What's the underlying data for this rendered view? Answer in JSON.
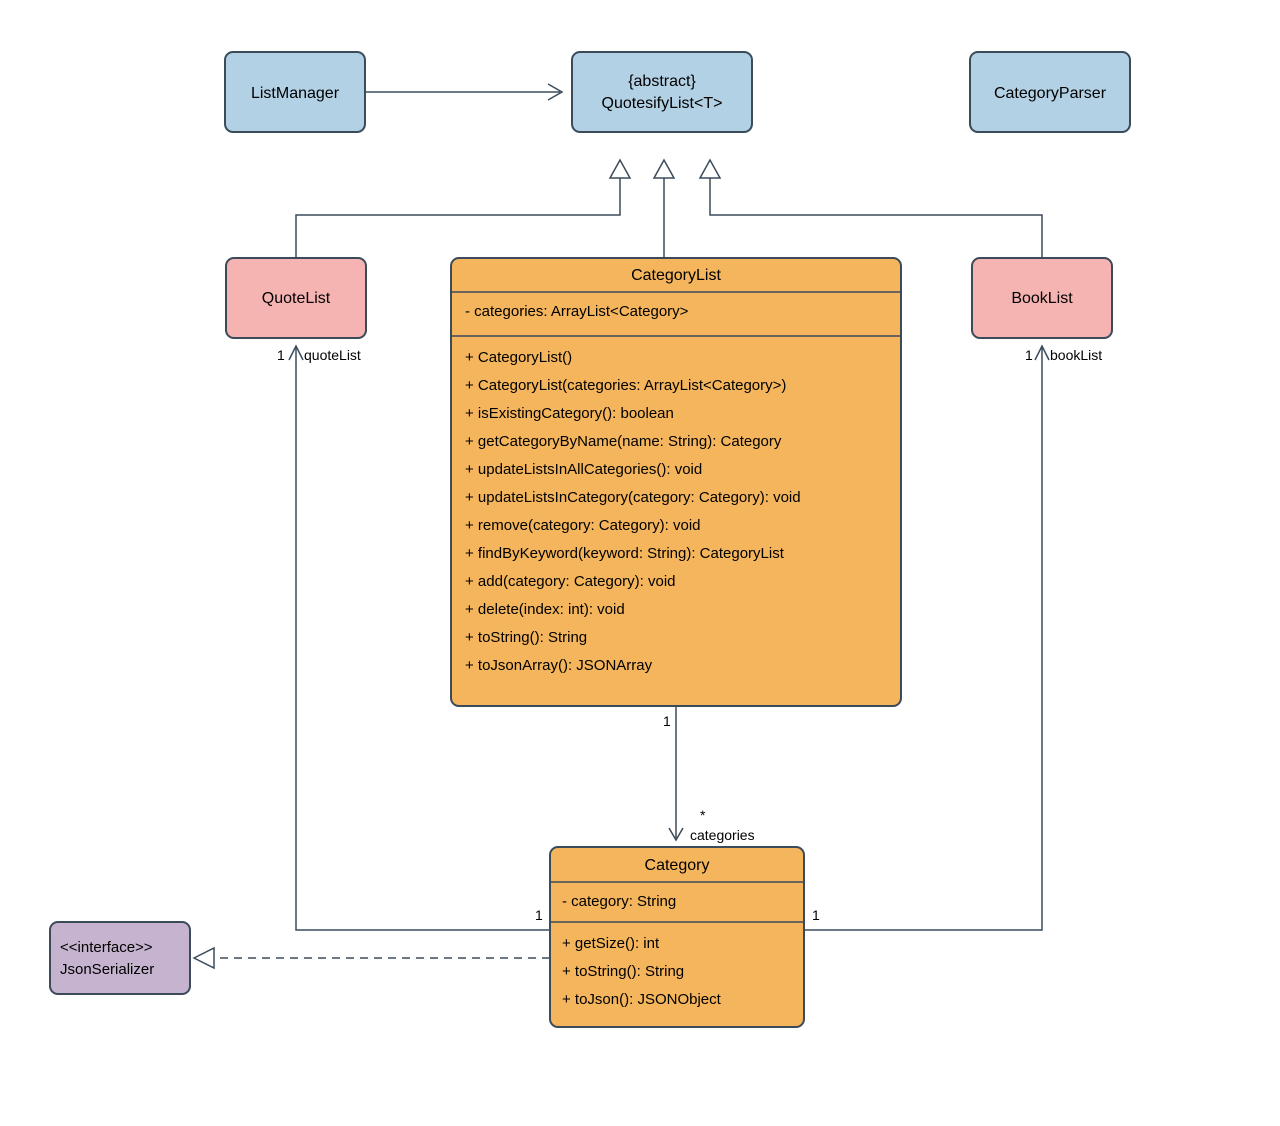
{
  "classes": {
    "listManager": {
      "name": "ListManager"
    },
    "quotesifyList": {
      "stereotype": "{abstract}",
      "name": "QuotesifyList<T>"
    },
    "categoryParser": {
      "name": "CategoryParser"
    },
    "quoteList": {
      "name": "QuoteList"
    },
    "bookList": {
      "name": "BookList"
    },
    "jsonSerializer": {
      "stereotype": "<<interface>>",
      "name": "JsonSerializer"
    },
    "categoryList": {
      "name": "CategoryList",
      "attributes": [
        "- categories: ArrayList<Category>"
      ],
      "operations": [
        "+ CategoryList()",
        "+ CategoryList(categories: ArrayList<Category>)",
        "+ isExistingCategory(): boolean",
        "+ getCategoryByName(name: String): Category",
        "+ updateListsInAllCategories(): void",
        "+ updateListsInCategory(category: Category): void",
        "+ remove(category: Category): void",
        "+ findByKeyword(keyword: String): CategoryList",
        "+ add(category: Category): void",
        "+ delete(index: int): void",
        "+ toString(): String",
        "+ toJsonArray(): JSONArray"
      ]
    },
    "category": {
      "name": "Category",
      "attributes": [
        "- category: String"
      ],
      "operations": [
        "+ getSize(): int",
        "+ toString(): String",
        "+ toJson(): JSONObject"
      ]
    }
  },
  "associations": {
    "quoteList": {
      "near": "1",
      "far": "1",
      "role": "quoteList"
    },
    "bookList": {
      "near": "1",
      "far": "1",
      "role": "bookList"
    },
    "categories": {
      "near": "1",
      "far": "*",
      "role": "categories"
    }
  }
}
